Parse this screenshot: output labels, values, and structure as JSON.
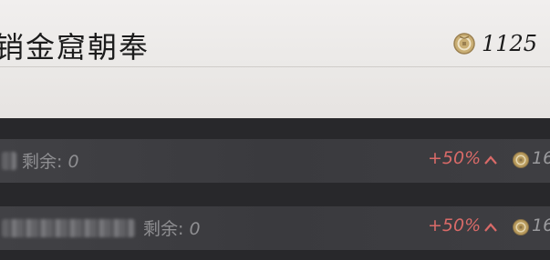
{
  "header": {
    "title": "销金窟朝奉",
    "currency_icon": "coin-icon",
    "currency_amount": "1125"
  },
  "items": [
    {
      "name_blurred": true,
      "remaining_label": "剩余",
      "remaining_sep": ":",
      "remaining_value": "0",
      "bonus": "+50%",
      "trend_icon": "chevron-up-icon",
      "price_icon": "coin-icon",
      "price": "16"
    },
    {
      "name_blurred": true,
      "remaining_label": "剩余",
      "remaining_sep": ":",
      "remaining_value": "0",
      "bonus": "+50%",
      "trend_icon": "chevron-up-icon",
      "price_icon": "coin-icon",
      "price": "16"
    }
  ],
  "colors": {
    "bonus": "#d96a68",
    "coin": "#b79a5c",
    "header_bg": "#eeecea",
    "list_bg": "#2c2c2f"
  }
}
